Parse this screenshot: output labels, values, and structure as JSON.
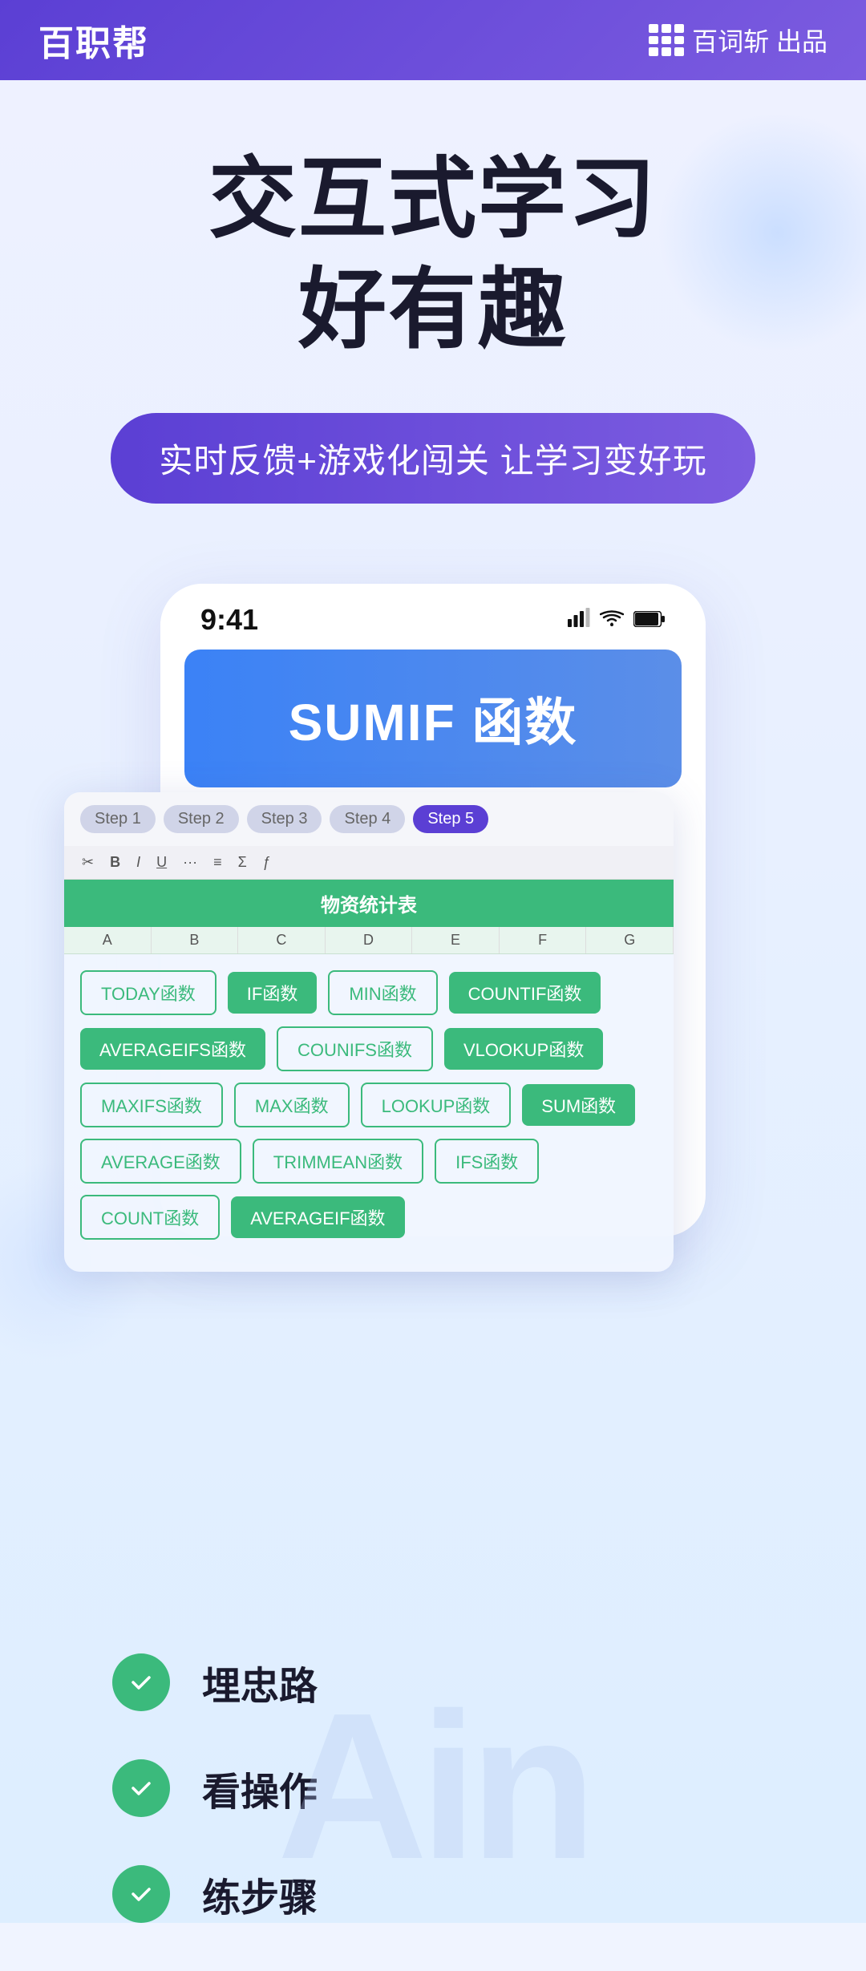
{
  "header": {
    "logo": "百职帮",
    "brand_icon_alt": "百词斩 grid icon",
    "brand_label": "百词斩 出品"
  },
  "hero": {
    "title_line1": "交互式学习",
    "title_line2": "好有趣",
    "badge": "实时反馈+游戏化闯关  让学习变好玩"
  },
  "phone": {
    "status_time": "9:41",
    "sumif_title": "SUMIF 函数"
  },
  "excel": {
    "step_tabs": [
      "Step 1",
      "Step 2",
      "Step 3",
      "Step 4",
      "Step 5"
    ],
    "active_step": 4,
    "sheet_title": "物资统计表",
    "func_tags": [
      {
        "label": "TODAY函数",
        "style": "outline"
      },
      {
        "label": "IF函数",
        "style": "green"
      },
      {
        "label": "MIN函数",
        "style": "outline"
      },
      {
        "label": "COUNTIF函数",
        "style": "green"
      },
      {
        "label": "AVERAGEIFS函数",
        "style": "green"
      },
      {
        "label": "COUNIFS函数",
        "style": "outline"
      },
      {
        "label": "VLOOKUP函数",
        "style": "green"
      },
      {
        "label": "MAXIFS函数",
        "style": "outline"
      },
      {
        "label": "MAX函数",
        "style": "outline"
      },
      {
        "label": "LOOKUP函数",
        "style": "outline"
      },
      {
        "label": "SUM函数",
        "style": "green"
      },
      {
        "label": "AVERAGE函数",
        "style": "outline"
      },
      {
        "label": "TRIMMEAN函数",
        "style": "outline"
      },
      {
        "label": "IFS函数",
        "style": "outline"
      },
      {
        "label": "COUNT函数",
        "style": "outline"
      },
      {
        "label": "AVERAGEIF函数",
        "style": "green"
      }
    ]
  },
  "steps": [
    {
      "label": "埋忠路",
      "checked": true
    },
    {
      "label": "看操作",
      "checked": true
    },
    {
      "label": "练步骤",
      "checked": true
    }
  ],
  "bottom_text": "Ain"
}
